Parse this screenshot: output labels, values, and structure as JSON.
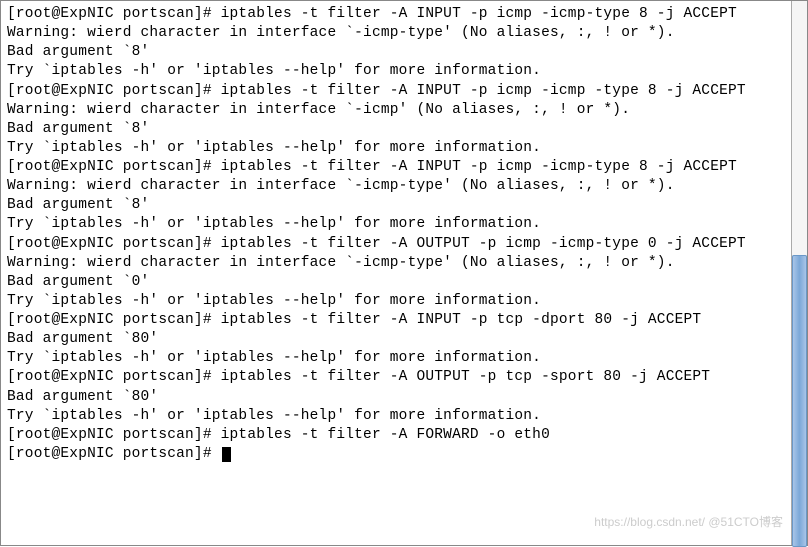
{
  "prompt": "[root@ExpNIC portscan]# ",
  "lines": [
    {
      "t": "prompt_cmd",
      "cmd": "iptables -t filter -A INPUT -p icmp -icmp-type 8 -j ACCEPT"
    },
    {
      "t": "out",
      "txt": "Warning: wierd character in interface `-icmp-type' (No aliases, :, ! or *)."
    },
    {
      "t": "out",
      "txt": "Bad argument `8'"
    },
    {
      "t": "out",
      "txt": "Try `iptables -h' or 'iptables --help' for more information."
    },
    {
      "t": "prompt_cmd",
      "cmd": "iptables -t filter -A INPUT -p icmp -icmp -type 8 -j ACCEPT"
    },
    {
      "t": "out",
      "txt": "Warning: wierd character in interface `-icmp' (No aliases, :, ! or *)."
    },
    {
      "t": "out",
      "txt": "Bad argument `8'"
    },
    {
      "t": "out",
      "txt": "Try `iptables -h' or 'iptables --help' for more information."
    },
    {
      "t": "prompt_cmd",
      "cmd": "iptables -t filter -A INPUT -p icmp -icmp-type 8 -j ACCEPT"
    },
    {
      "t": "out",
      "txt": "Warning: wierd character in interface `-icmp-type' (No aliases, :, ! or *)."
    },
    {
      "t": "out",
      "txt": "Bad argument `8'"
    },
    {
      "t": "out",
      "txt": "Try `iptables -h' or 'iptables --help' for more information."
    },
    {
      "t": "prompt_cmd",
      "cmd": "iptables -t filter -A OUTPUT -p icmp -icmp-type 0 -j ACCEPT"
    },
    {
      "t": "out",
      "txt": "Warning: wierd character in interface `-icmp-type' (No aliases, :, ! or *)."
    },
    {
      "t": "out",
      "txt": "Bad argument `0'"
    },
    {
      "t": "out",
      "txt": "Try `iptables -h' or 'iptables --help' for more information."
    },
    {
      "t": "prompt_cmd",
      "cmd": "iptables -t filter -A INPUT -p tcp -dport 80 -j ACCEPT"
    },
    {
      "t": "out",
      "txt": "Bad argument `80'"
    },
    {
      "t": "out",
      "txt": "Try `iptables -h' or 'iptables --help' for more information."
    },
    {
      "t": "prompt_cmd",
      "cmd": "iptables -t filter -A OUTPUT -p tcp -sport 80 -j ACCEPT"
    },
    {
      "t": "out",
      "txt": "Bad argument `80'"
    },
    {
      "t": "out",
      "txt": "Try `iptables -h' or 'iptables --help' for more information."
    },
    {
      "t": "prompt_cmd",
      "cmd": "iptables -t filter -A FORWARD -o eth0"
    },
    {
      "t": "prompt_cursor"
    }
  ],
  "watermark": "https://blog.csdn.net/   @51CTO博客"
}
